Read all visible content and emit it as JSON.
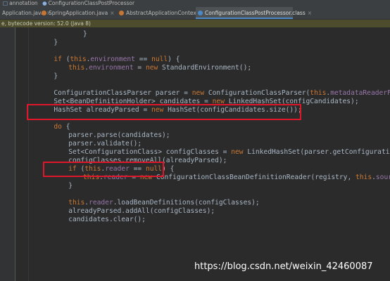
{
  "breadcrumb": {
    "items": [
      "annotation",
      "ConfigurationClassPostProcessor"
    ]
  },
  "tabs": [
    {
      "label": "Application.java",
      "icon_color": "#c57633",
      "active": false
    },
    {
      "label": "SpringApplication.java",
      "icon_color": "#c57633",
      "active": false
    },
    {
      "label": "AbstractApplicationContext.class",
      "icon_color": "#c57633",
      "active": false
    },
    {
      "label": "ConfigurationClassPostProcessor.class",
      "icon_color": "#4a88c7",
      "active": true
    }
  ],
  "infobar": {
    "text": "e, bytecode version: 52.0 (Java 8)"
  },
  "code": [
    {
      "indent": 5,
      "tokens": [
        {
          "t": "}",
          "c": ""
        }
      ]
    },
    {
      "indent": 3,
      "tokens": [
        {
          "t": "}",
          "c": ""
        }
      ]
    },
    {
      "indent": 0,
      "tokens": []
    },
    {
      "indent": 3,
      "tokens": [
        {
          "t": "if",
          "c": "kw"
        },
        {
          "t": " (",
          "c": ""
        },
        {
          "t": "this",
          "c": "kw"
        },
        {
          "t": ".",
          "c": ""
        },
        {
          "t": "environment",
          "c": "fld"
        },
        {
          "t": " == ",
          "c": ""
        },
        {
          "t": "null",
          "c": "kw"
        },
        {
          "t": ") {",
          "c": ""
        }
      ]
    },
    {
      "indent": 4,
      "tokens": [
        {
          "t": "this",
          "c": "kw"
        },
        {
          "t": ".",
          "c": ""
        },
        {
          "t": "environment",
          "c": "fld"
        },
        {
          "t": " = ",
          "c": ""
        },
        {
          "t": "new",
          "c": "kw"
        },
        {
          "t": " StandardEnvironment();",
          "c": ""
        }
      ]
    },
    {
      "indent": 3,
      "tokens": [
        {
          "t": "}",
          "c": ""
        }
      ]
    },
    {
      "indent": 0,
      "tokens": []
    },
    {
      "indent": 3,
      "tokens": [
        {
          "t": "ConfigurationClassParser parser = ",
          "c": ""
        },
        {
          "t": "new",
          "c": "kw"
        },
        {
          "t": " ConfigurationClassParser(",
          "c": ""
        },
        {
          "t": "this",
          "c": "kw"
        },
        {
          "t": ".",
          "c": ""
        },
        {
          "t": "metadataReaderFactory",
          "c": "fld"
        },
        {
          "t": ", ",
          "c": ""
        },
        {
          "t": "this",
          "c": "kw"
        },
        {
          "t": ".p",
          "c": "fld"
        }
      ]
    },
    {
      "indent": 3,
      "tokens": [
        {
          "t": "Set<BeanDefinitionHolder> candidates = ",
          "c": ""
        },
        {
          "t": "new",
          "c": "kw"
        },
        {
          "t": " LinkedHashSet(configCandidates);",
          "c": ""
        }
      ]
    },
    {
      "indent": 3,
      "tokens": [
        {
          "t": "HashSet alreadyParsed = ",
          "c": ""
        },
        {
          "t": "new",
          "c": "kw"
        },
        {
          "t": " HashSet(configCandidates.size());",
          "c": ""
        }
      ]
    },
    {
      "indent": 0,
      "tokens": []
    },
    {
      "indent": 3,
      "tokens": [
        {
          "t": "do",
          "c": "kw"
        },
        {
          "t": " {",
          "c": ""
        }
      ]
    },
    {
      "indent": 4,
      "tokens": [
        {
          "t": "parser.parse(candidates);",
          "c": ""
        }
      ]
    },
    {
      "indent": 4,
      "tokens": [
        {
          "t": "parser.validate();",
          "c": ""
        }
      ]
    },
    {
      "indent": 4,
      "tokens": [
        {
          "t": "Set<ConfigurationClass> configClasses = ",
          "c": ""
        },
        {
          "t": "new",
          "c": "kw"
        },
        {
          "t": " LinkedHashSet(parser.getConfigurationClasses());",
          "c": ""
        }
      ]
    },
    {
      "indent": 4,
      "tokens": [
        {
          "t": "configClasses.removeAll(alreadyParsed);",
          "c": ""
        }
      ]
    },
    {
      "indent": 4,
      "tokens": [
        {
          "t": "if",
          "c": "kw"
        },
        {
          "t": " (",
          "c": ""
        },
        {
          "t": "this",
          "c": "kw"
        },
        {
          "t": ".",
          "c": ""
        },
        {
          "t": "reader",
          "c": "fld"
        },
        {
          "t": " == ",
          "c": ""
        },
        {
          "t": "null",
          "c": "kw"
        },
        {
          "t": ") {",
          "c": ""
        }
      ]
    },
    {
      "indent": 5,
      "tokens": [
        {
          "t": "this",
          "c": "kw"
        },
        {
          "t": ".",
          "c": ""
        },
        {
          "t": "reader",
          "c": "fld"
        },
        {
          "t": " = ",
          "c": ""
        },
        {
          "t": "new",
          "c": "kw"
        },
        {
          "t": " ConfigurationClassBeanDefinitionReader(registry, ",
          "c": ""
        },
        {
          "t": "this",
          "c": "kw"
        },
        {
          "t": ".",
          "c": ""
        },
        {
          "t": "sourceExtractor",
          "c": "fld"
        },
        {
          "t": ",",
          "c": ""
        }
      ]
    },
    {
      "indent": 4,
      "tokens": [
        {
          "t": "}",
          "c": ""
        }
      ]
    },
    {
      "indent": 0,
      "tokens": []
    },
    {
      "indent": 4,
      "tokens": [
        {
          "t": "this",
          "c": "kw"
        },
        {
          "t": ".",
          "c": ""
        },
        {
          "t": "reader",
          "c": "fld"
        },
        {
          "t": ".loadBeanDefinitions(configClasses);",
          "c": ""
        }
      ]
    },
    {
      "indent": 4,
      "tokens": [
        {
          "t": "alreadyParsed.addAll(configClasses);",
          "c": ""
        }
      ]
    },
    {
      "indent": 4,
      "tokens": [
        {
          "t": "candidates.clear();",
          "c": ""
        }
      ]
    }
  ],
  "highlights": [
    {
      "label": "highlight-configurationclassparser"
    },
    {
      "label": "highlight-parser-parse"
    }
  ],
  "watermark": {
    "text": "https://blog.csdn.net/weixin_42460087"
  },
  "colors": {
    "keyword": "#cc7832",
    "field": "#9876aa",
    "text": "#a9b7c6",
    "highlight": "#e0162b"
  }
}
